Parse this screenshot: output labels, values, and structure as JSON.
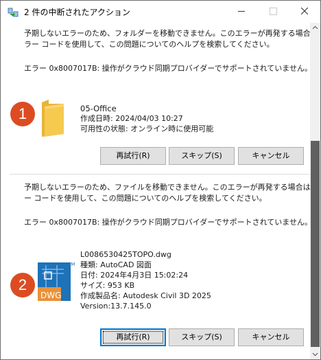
{
  "window": {
    "title": "2 件の中断されたアクション",
    "title_icon": "move-files-icon"
  },
  "items": [
    {
      "message_line1": "予期しないエラーのため、フォルダーを移動できません。このエラーが再発する場合は、エ",
      "message_line2": "ラー コードを使用して、この問題についてのヘルプを検索してください。",
      "error": "エラー 0x8007017B: 操作がクラウド同期プロバイダーでサポートされていません。",
      "badge": "1",
      "icon": "folder-icon",
      "details": [
        "05-Office",
        "作成日時: 2024/04/03 10:27",
        "可用性の状態: オンライン時に使用可能"
      ],
      "buttons": {
        "retry": "再試行(R)",
        "skip": "スキップ(S)",
        "cancel": "キャンセル"
      }
    },
    {
      "message_line1": "予期しないエラーのため、ファイルを移動できません。このエラーが再発する場合は、エラ",
      "message_line2": "ー コードを使用して、この問題についてのヘルプを検索してください。",
      "error": "エラー 0x8007017B: 操作がクラウド同期プロバイダーでサポートされていません。",
      "badge": "2",
      "icon": "dwg-file-icon",
      "icon_label": "DWG",
      "icon_tm": "TM",
      "details": [
        "L0086530425TOPO.dwg",
        "種類: AutoCAD 図面",
        "日付: 2024年4月3日 15:02:24",
        "サイズ: 953 KB",
        "作成製品名: Autodesk Civil 3D 2025",
        "Version:13.7.145.0"
      ],
      "buttons": {
        "retry": "再試行(R)",
        "skip": "スキップ(S)",
        "cancel": "キャンセル"
      }
    }
  ],
  "colors": {
    "badge": "#dc4c22",
    "folder": "#f6c94f",
    "dwg_blue": "#1d72b8",
    "dwg_orange": "#e8923a",
    "scroll_thumb": "#606060"
  }
}
